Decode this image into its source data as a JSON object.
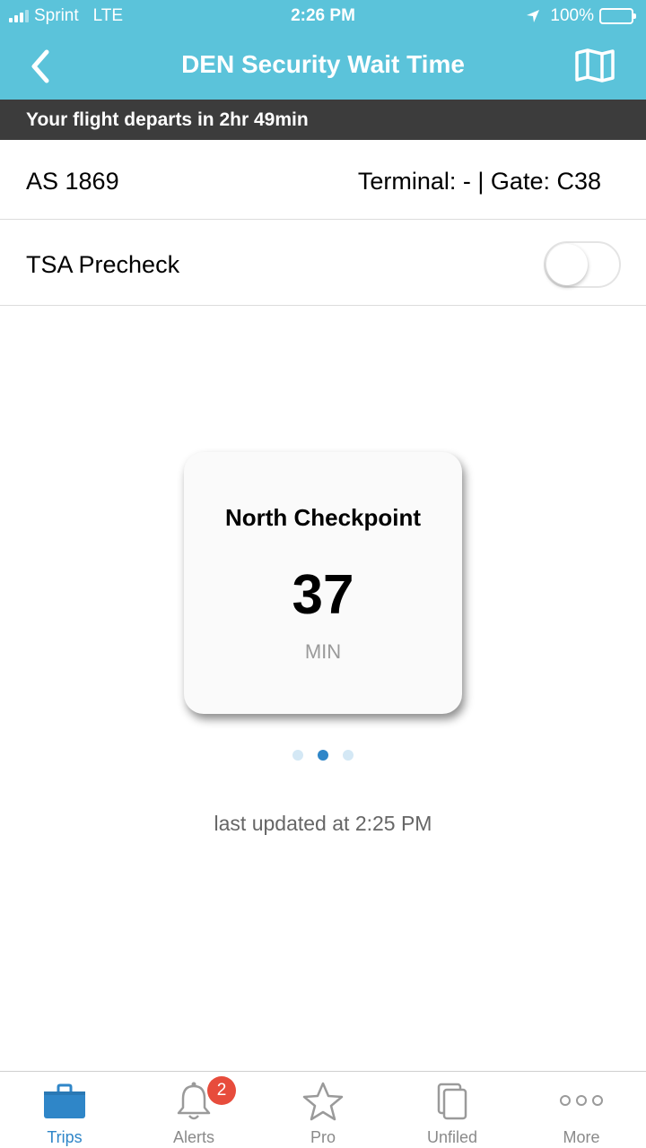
{
  "status_bar": {
    "carrier": "Sprint",
    "network": "LTE",
    "time": "2:26 PM",
    "battery": "100%"
  },
  "nav": {
    "title": "DEN Security Wait Time",
    "back_icon": "chevron-left-icon",
    "map_icon": "map-icon"
  },
  "departure_banner": "Your flight departs in 2hr 49min",
  "flight": {
    "number": "AS 1869",
    "terminal_gate": "Terminal: - | Gate: C38"
  },
  "tsa_precheck": {
    "label": "TSA Precheck",
    "enabled": false
  },
  "checkpoint": {
    "name": "North Checkpoint",
    "wait_value": "37",
    "wait_unit": "MIN"
  },
  "pager": {
    "count": 3,
    "active_index": 1
  },
  "last_updated": "last updated at 2:25 PM",
  "colors": {
    "header": "#5bc3da",
    "banner": "#3c3c3c",
    "accent": "#2f86c8",
    "badge": "#e74c3c"
  },
  "tabs": [
    {
      "label": "Trips",
      "icon": "briefcase-icon",
      "active": true
    },
    {
      "label": "Alerts",
      "icon": "bell-icon",
      "badge": "2"
    },
    {
      "label": "Pro",
      "icon": "star-icon"
    },
    {
      "label": "Unfiled",
      "icon": "documents-icon"
    },
    {
      "label": "More",
      "icon": "more-dots-icon"
    }
  ]
}
